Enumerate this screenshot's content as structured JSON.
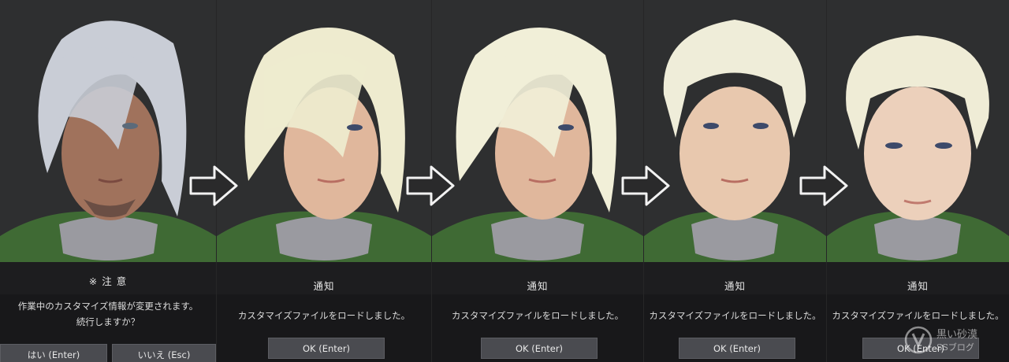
{
  "panels": [
    {
      "hair_color": "#c9cdd6",
      "dialog": {
        "title": "※ 注 意",
        "message_line1": "作業中のカスタマイズ情報が変更されます。",
        "message_line2": "続行しますか？",
        "confirm_label": "はい (Enter)",
        "cancel_label": "いいえ (Esc)"
      }
    },
    {
      "hair_color": "#eeebcf",
      "dialog": {
        "title": "通知",
        "message": "カスタマイズファイルをロードしました。",
        "ok_label": "OK (Enter)"
      }
    },
    {
      "hair_color": "#f1efd8",
      "dialog": {
        "title": "通知",
        "message": "カスタマイズファイルをロードしました。",
        "ok_label": "OK (Enter)"
      }
    },
    {
      "hair_color": "#efedd9",
      "dialog": {
        "title": "通知",
        "message": "カスタマイズファイルをロードしました。",
        "ok_label": "OK (Enter)"
      }
    },
    {
      "hair_color": "#efecd6",
      "dialog": {
        "title": "通知",
        "message": "カスタマイズファイルをロードしました。",
        "ok_label": "OK (Enter)"
      }
    }
  ],
  "arrows": [
    "right-arrow-icon",
    "right-arrow-icon",
    "right-arrow-icon",
    "right-arrow-icon"
  ],
  "watermark": {
    "line1": "黒い砂漠",
    "line2": "SSブログ"
  }
}
